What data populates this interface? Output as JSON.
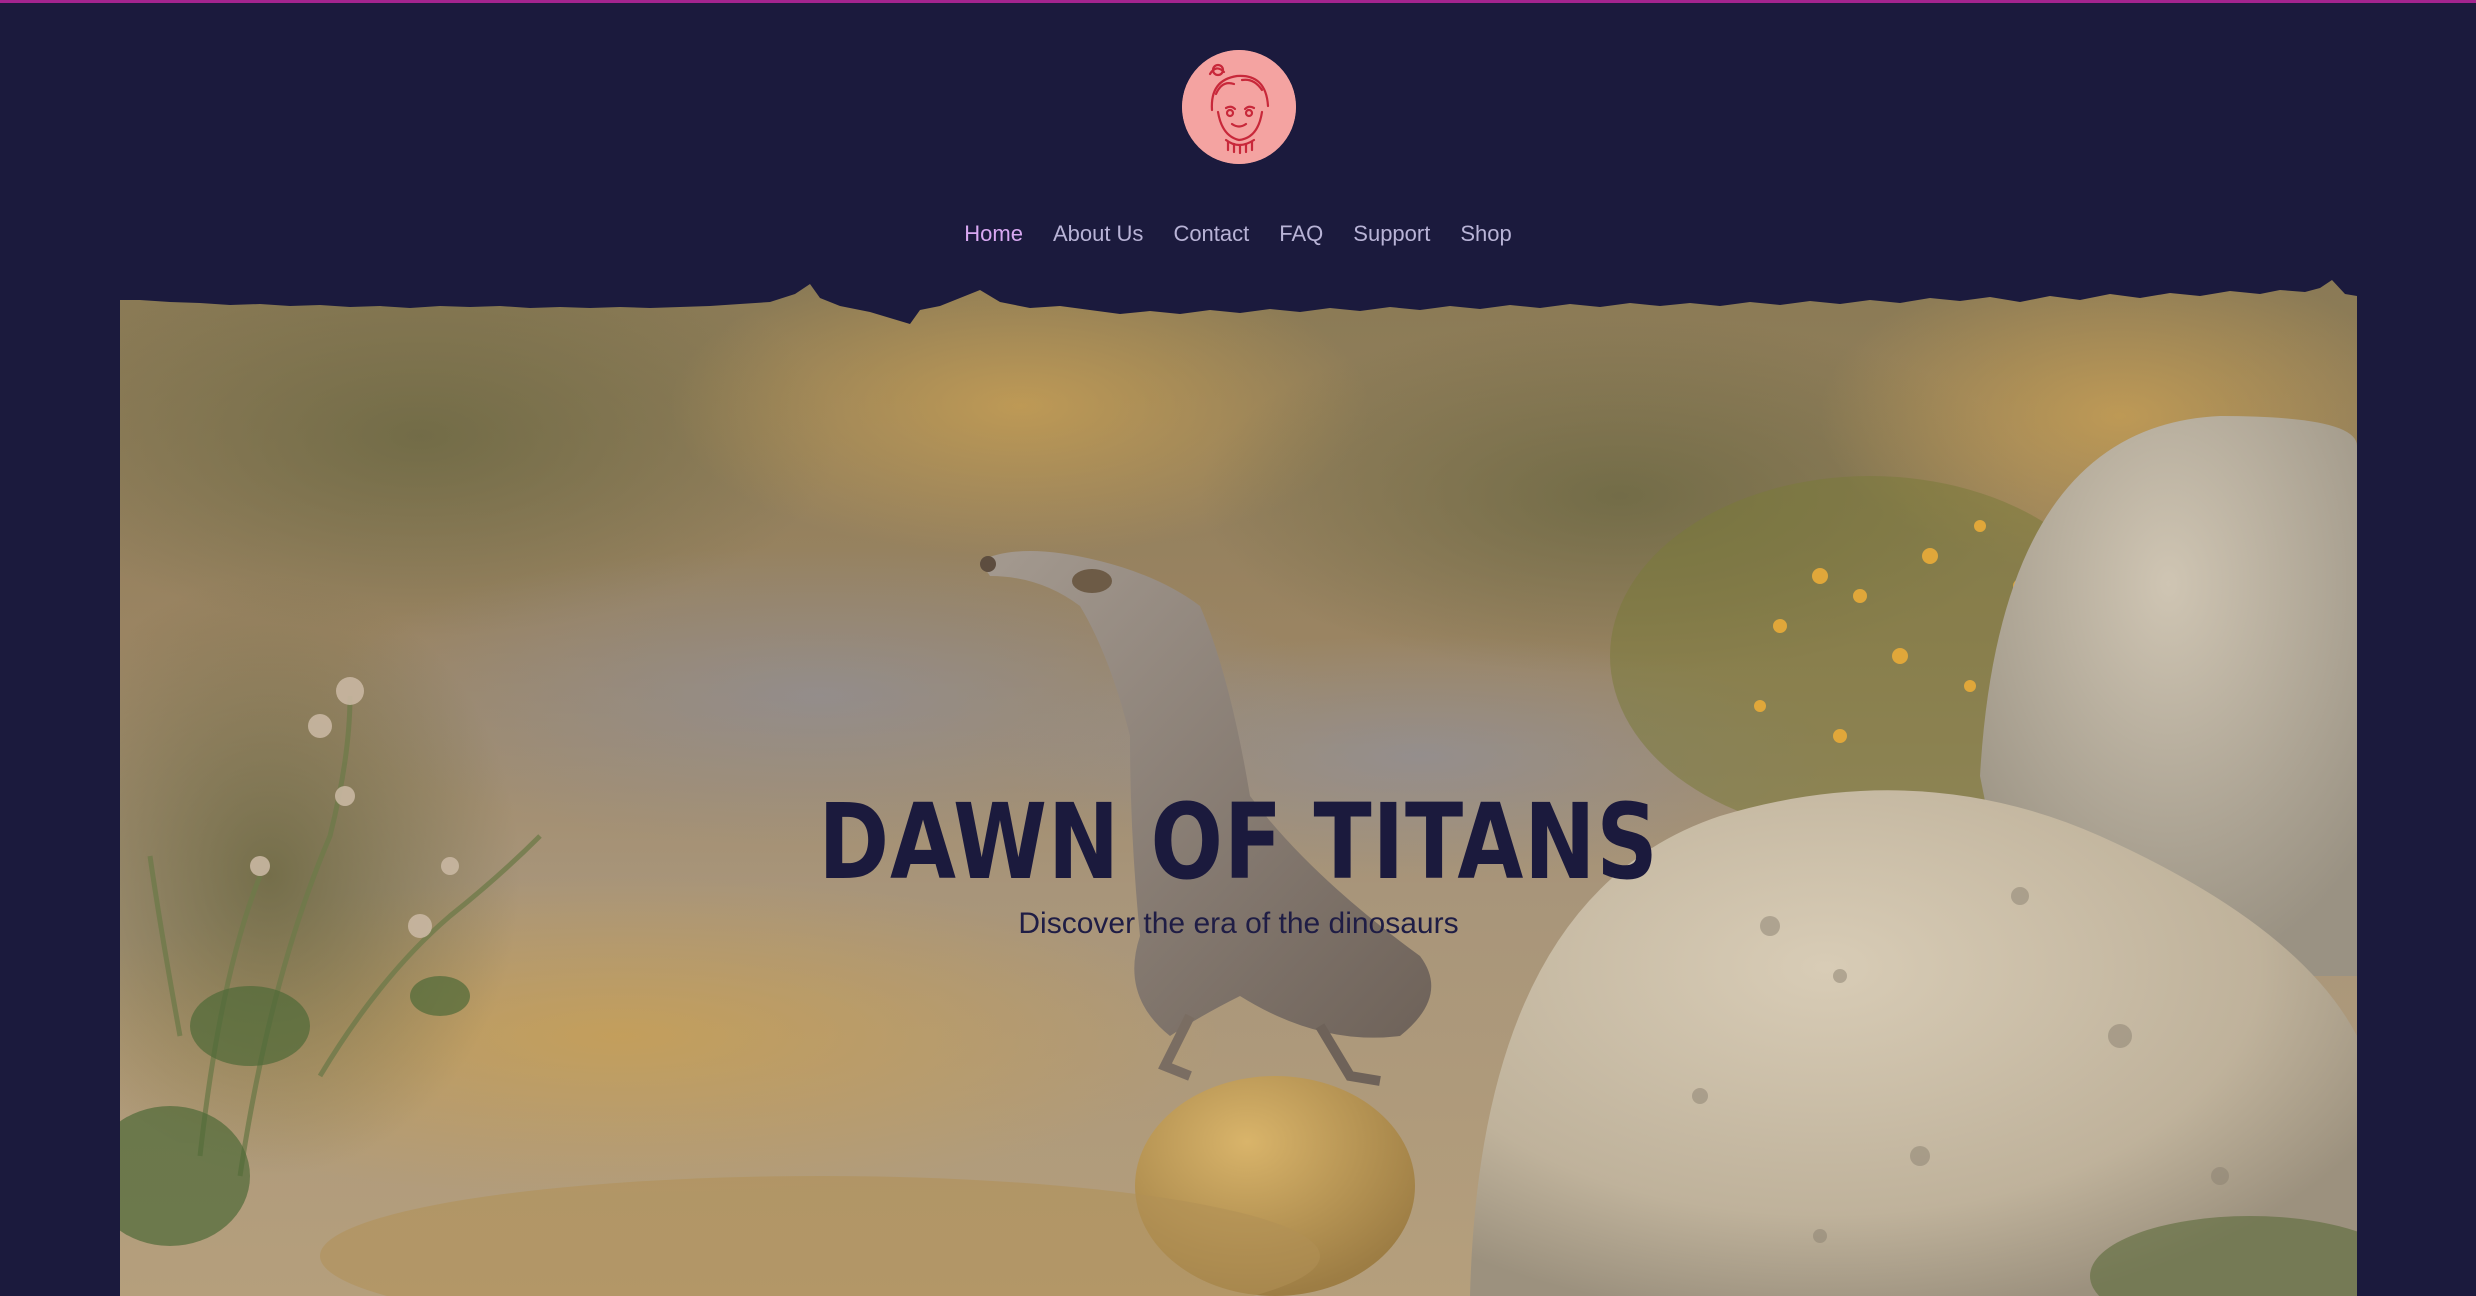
{
  "colors": {
    "background": "#1b1a3d",
    "top_line": "#a3248f",
    "nav_text": "#b8b3d6",
    "nav_active": "#d9a8f2",
    "logo_bg": "#f4a3a1",
    "title": "#1b1a3d"
  },
  "header": {
    "logo_icon": "anime-character-avatar-icon",
    "nav": [
      {
        "label": "Home",
        "active": true
      },
      {
        "label": "About Us",
        "active": false
      },
      {
        "label": "Contact",
        "active": false
      },
      {
        "label": "FAQ",
        "active": false
      },
      {
        "label": "Support",
        "active": false
      },
      {
        "label": "Shop",
        "active": false
      }
    ]
  },
  "hero": {
    "title": "DAWN OF TITANS",
    "subtitle": "Discover the era of the dinosaurs",
    "image_icon": "desert-bird-photo"
  }
}
